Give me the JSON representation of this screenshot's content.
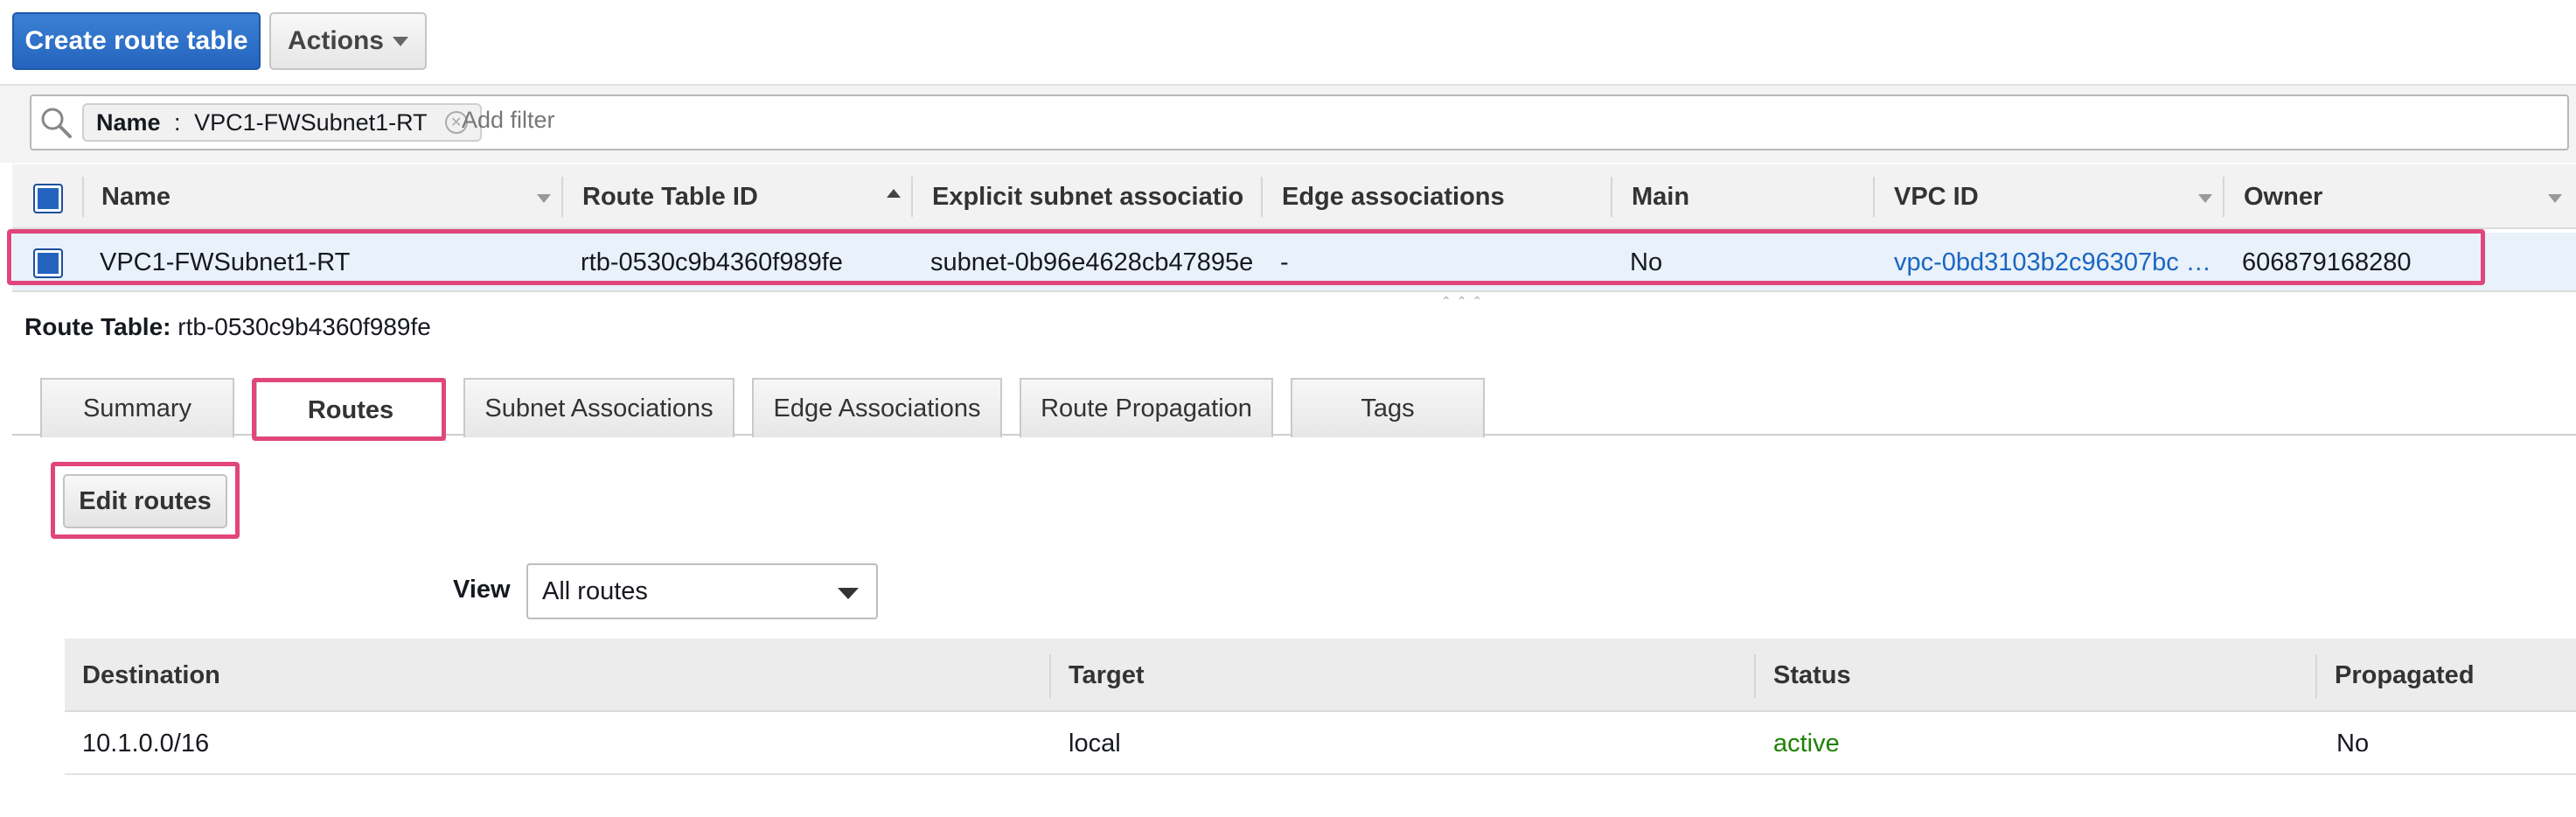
{
  "toolbar": {
    "create_label": "Create route table",
    "actions_label": "Actions"
  },
  "filter": {
    "chip_key": "Name",
    "chip_sep": " : ",
    "chip_value": "VPC1-FWSubnet1-RT",
    "placeholder": "Add filter"
  },
  "table": {
    "columns": [
      "Name",
      "Route Table ID",
      "Explicit subnet association",
      "Edge associations",
      "Main",
      "VPC ID",
      "Owner"
    ],
    "row": {
      "name": "VPC1-FWSubnet1-RT",
      "route_table_id": "rtb-0530c9b4360f989fe",
      "subnet_association": "subnet-0b96e4628cb47895e",
      "edge_associations": "-",
      "main": "No",
      "vpc_id": "vpc-0bd3103b2c96307bc …",
      "owner": "606879168280"
    }
  },
  "detail": {
    "label": "Route Table:",
    "value": "rtb-0530c9b4360f989fe",
    "tabs": [
      "Summary",
      "Routes",
      "Subnet Associations",
      "Edge Associations",
      "Route Propagation",
      "Tags"
    ],
    "active_tab": "Routes",
    "edit_label": "Edit routes",
    "view_label": "View",
    "view_value": "All routes"
  },
  "routes": {
    "columns": [
      "Destination",
      "Target",
      "Status",
      "Propagated"
    ],
    "rows": [
      {
        "destination": "10.1.0.0/16",
        "target": "local",
        "status": "active",
        "propagated": "No"
      }
    ]
  },
  "colors": {
    "primary": "#2564be",
    "highlight": "#e0467c",
    "status_active": "#1d8102",
    "link": "#1a66c2"
  }
}
